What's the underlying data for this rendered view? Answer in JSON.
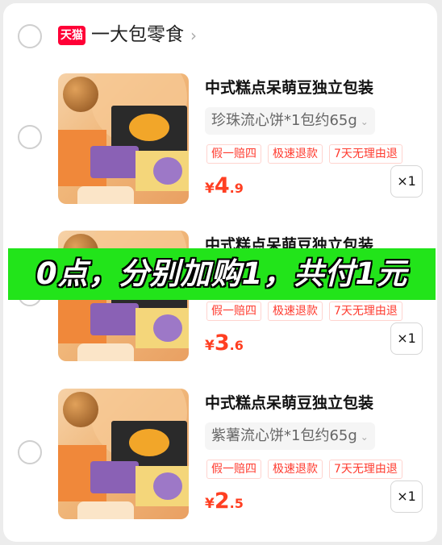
{
  "shop": {
    "badge": "天猫",
    "name": "一大包零食",
    "chevron": "›"
  },
  "items": [
    {
      "title": "中式糕点呆萌豆独立包装",
      "variant": "珍珠流心饼*1包约65g",
      "tags": [
        "假一赔四",
        "极速退款",
        "7天无理由退"
      ],
      "price_currency": "¥",
      "price_int": "4",
      "price_dec": ".9",
      "qty": "×1"
    },
    {
      "title": "中式糕点呆萌豆独立包装",
      "variant": "",
      "tags": [
        "假一赔四",
        "极速退款",
        "7天无理由退"
      ],
      "price_currency": "¥",
      "price_int": "3",
      "price_dec": ".6",
      "qty": "×1"
    },
    {
      "title": "中式糕点呆萌豆独立包装",
      "variant": "紫薯流心饼*1包约65g",
      "tags": [
        "假一赔四",
        "极速退款",
        "7天无理由退"
      ],
      "price_currency": "¥",
      "price_int": "2",
      "price_dec": ".5",
      "qty": "×1"
    }
  ],
  "banner": {
    "text": "0点，分别加购1，共付1元"
  },
  "colors": {
    "price_red": "#ff3f22",
    "tmall_red": "#ff0036",
    "banner_green": "#22e41a"
  },
  "icons": {
    "select": "radio-circle-icon",
    "variant_caret": "chevron-down-icon",
    "shop_chevron": "chevron-right-icon"
  }
}
